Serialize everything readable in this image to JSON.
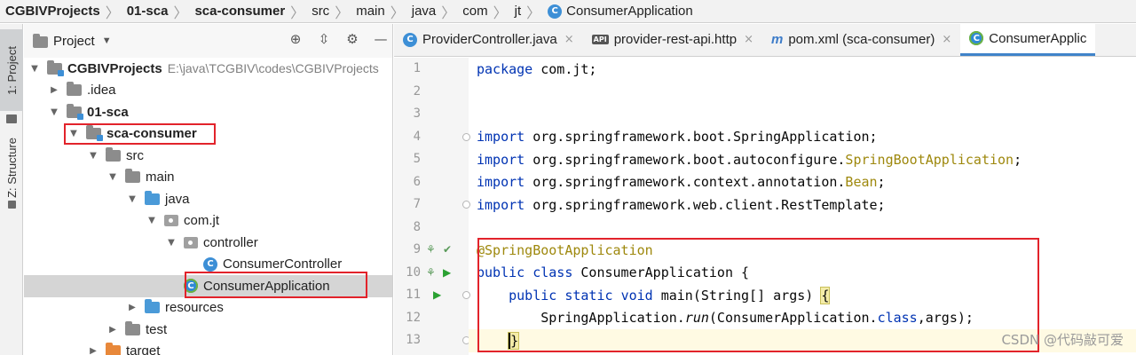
{
  "breadcrumb": [
    {
      "label": "CGBIVProjects",
      "bold": true
    },
    {
      "label": "01-sca",
      "bold": true
    },
    {
      "label": "sca-consumer",
      "bold": true
    },
    {
      "label": "src",
      "bold": false
    },
    {
      "label": "main",
      "bold": false
    },
    {
      "label": "java",
      "bold": false
    },
    {
      "label": "com",
      "bold": false
    },
    {
      "label": "jt",
      "bold": false
    },
    {
      "label": "ConsumerApplication",
      "bold": false
    }
  ],
  "toolstrip": {
    "project_tab": "1: Project",
    "structure_tab": "Z: Structure"
  },
  "project_panel": {
    "title": "Project",
    "tree": [
      {
        "label": "CGBIVProjects",
        "path": "E:\\java\\TCGBIV\\codes\\CGBIVProjects",
        "bold": true,
        "expanded": true,
        "depth": 0,
        "icon": "module-folder-icon"
      },
      {
        "label": ".idea",
        "bold": false,
        "expanded": false,
        "depth": 1,
        "icon": "folder-icon"
      },
      {
        "label": "01-sca",
        "bold": true,
        "expanded": true,
        "depth": 1,
        "icon": "module-folder-icon"
      },
      {
        "label": "sca-consumer",
        "bold": true,
        "expanded": true,
        "depth": 2,
        "icon": "module-folder-icon"
      },
      {
        "label": "src",
        "bold": false,
        "expanded": true,
        "depth": 3,
        "icon": "folder-icon"
      },
      {
        "label": "main",
        "bold": false,
        "expanded": true,
        "depth": 4,
        "icon": "folder-icon"
      },
      {
        "label": "java",
        "bold": false,
        "expanded": true,
        "depth": 5,
        "icon": "source-folder-icon"
      },
      {
        "label": "com.jt",
        "bold": false,
        "expanded": true,
        "depth": 6,
        "icon": "package-icon"
      },
      {
        "label": "controller",
        "bold": false,
        "expanded": true,
        "depth": 7,
        "icon": "package-icon"
      },
      {
        "label": "ConsumerController",
        "bold": false,
        "expanded": null,
        "depth": 8,
        "icon": "class-icon"
      },
      {
        "label": "ConsumerApplication",
        "bold": false,
        "expanded": null,
        "depth": 7,
        "icon": "spring-boot-class-icon",
        "selected": true
      },
      {
        "label": "resources",
        "bold": false,
        "expanded": false,
        "depth": 5,
        "icon": "resources-folder-icon"
      },
      {
        "label": "test",
        "bold": false,
        "expanded": false,
        "depth": 4,
        "icon": "folder-icon"
      },
      {
        "label": "target",
        "bold": false,
        "expanded": false,
        "depth": 3,
        "icon": "target-folder-icon"
      }
    ]
  },
  "editor": {
    "tabs": [
      {
        "label": "ProviderController.java",
        "icon": "class-icon",
        "active": false
      },
      {
        "label": "provider-rest-api.http",
        "icon": "api-icon",
        "active": false
      },
      {
        "label": "pom.xml (sca-consumer)",
        "icon": "maven-icon",
        "active": false
      },
      {
        "label": "ConsumerApplic",
        "icon": "spring-boot-class-icon",
        "active": true
      }
    ],
    "icon_labels": {
      "class": "C",
      "api": "API",
      "maven": "m",
      "close": "×"
    },
    "lines": [
      {
        "no": "1",
        "tokens": [
          {
            "t": "package",
            "c": "kw"
          },
          {
            "t": " com.jt;",
            "c": ""
          }
        ]
      },
      {
        "no": "2",
        "tokens": []
      },
      {
        "no": "3",
        "tokens": []
      },
      {
        "no": "4",
        "tokens": [
          {
            "t": "import",
            "c": "kw"
          },
          {
            "t": " org.springframework.boot.SpringApplication;",
            "c": ""
          }
        ]
      },
      {
        "no": "5",
        "tokens": [
          {
            "t": "import",
            "c": "kw"
          },
          {
            "t": " org.springframework.boot.autoconfigure.",
            "c": ""
          },
          {
            "t": "SpringBootApplication",
            "c": "ann"
          },
          {
            "t": ";",
            "c": ""
          }
        ]
      },
      {
        "no": "6",
        "tokens": [
          {
            "t": "import",
            "c": "kw"
          },
          {
            "t": " org.springframework.context.annotation.",
            "c": ""
          },
          {
            "t": "Bean",
            "c": "ann"
          },
          {
            "t": ";",
            "c": ""
          }
        ]
      },
      {
        "no": "7",
        "tokens": [
          {
            "t": "import",
            "c": "kw"
          },
          {
            "t": " org.springframework.web.client.RestTemplate;",
            "c": ""
          }
        ]
      },
      {
        "no": "8",
        "tokens": []
      },
      {
        "no": "9",
        "tokens": [
          {
            "t": "@SpringBootApplication",
            "c": "ann"
          }
        ]
      },
      {
        "no": "10",
        "tokens": [
          {
            "t": "public",
            "c": "kw"
          },
          {
            "t": " ",
            "c": ""
          },
          {
            "t": "class",
            "c": "kw"
          },
          {
            "t": " ConsumerApplication {",
            "c": ""
          }
        ]
      },
      {
        "no": "11",
        "tokens": [
          {
            "t": "    ",
            "c": ""
          },
          {
            "t": "public",
            "c": "kw"
          },
          {
            "t": " ",
            "c": ""
          },
          {
            "t": "static",
            "c": "kw"
          },
          {
            "t": " ",
            "c": ""
          },
          {
            "t": "void",
            "c": "kw"
          },
          {
            "t": " main(String[] args) ",
            "c": ""
          },
          {
            "t": "{",
            "c": "hl"
          }
        ]
      },
      {
        "no": "12",
        "tokens": [
          {
            "t": "        SpringApplication.",
            "c": ""
          },
          {
            "t": "run",
            "c": "it"
          },
          {
            "t": "(ConsumerApplication.",
            "c": ""
          },
          {
            "t": "class",
            "c": "kw"
          },
          {
            "t": ",args);",
            "c": ""
          }
        ]
      },
      {
        "no": "13",
        "tokens": [
          {
            "t": "    ",
            "c": ""
          },
          {
            "t": "}",
            "c": "hl cursor"
          }
        ],
        "current": true
      }
    ]
  },
  "watermark": "CSDN @代码敲可爱"
}
